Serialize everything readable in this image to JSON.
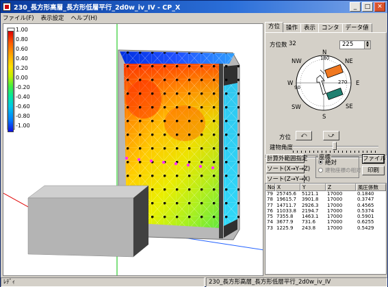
{
  "window": {
    "title": "230_長方形高層_長方形低層平行_2d0w_iv_IV - CP_X",
    "buttons": {
      "minimize": "_",
      "maximize": "□",
      "close": "✕"
    }
  },
  "menu": [
    "ファイル(F)",
    "表示設定",
    "ヘルプ(H)"
  ],
  "legend": {
    "labels": [
      "1.00",
      "0.80",
      "0.60",
      "0.40",
      "0.20",
      "0.00",
      "-0.20",
      "-0.40",
      "-0.60",
      "-0.80",
      "-1.00"
    ],
    "colors": {
      "high": "#e00000",
      "mid": "#ffe000",
      "low": "#1010e0"
    }
  },
  "tabs": [
    "方位",
    "操作",
    "表示",
    "コンタ",
    "データ値"
  ],
  "direction": {
    "count_label": "方位数",
    "count_value": "32",
    "angle_value": "225",
    "compass": [
      "N",
      "NE",
      "E",
      "SE",
      "S",
      "SW",
      "W",
      "NW"
    ],
    "compass_ticks": [
      "180",
      "90",
      "270"
    ],
    "direction_label": "方位",
    "rotate_left": "⤺",
    "rotate_right": "⤻",
    "building_angle_label": "建物角度"
  },
  "actions": {
    "range_button": "計算外範囲指定",
    "sort_xyz_button": "ソート(X→Y→Z)",
    "sort_zyx_button": "ソート(Z→Y→X)",
    "coords_group": "座標",
    "coords_absolute": "絶対",
    "coords_relative": "建物座標の相対",
    "file_button": "ファイル",
    "print_button": "印刷"
  },
  "table": {
    "headers": [
      "No",
      "X",
      "Y",
      "Z",
      "風圧係数"
    ],
    "rows": [
      [
        "79",
        "25745.6",
        "5121.1",
        "17000",
        "0.1840"
      ],
      [
        "78",
        "19615.7",
        "3901.8",
        "17000",
        "0.3747"
      ],
      [
        "77",
        "14711.7",
        "2926.3",
        "17000",
        "0.4565"
      ],
      [
        "76",
        "11033.8",
        "2194.7",
        "17000",
        "0.5374"
      ],
      [
        "75",
        "7355.8",
        "1463.1",
        "17000",
        "0.5901"
      ],
      [
        "74",
        "3677.9",
        "731.6",
        "17000",
        "0.6255"
      ],
      [
        "73",
        "1225.9",
        "243.8",
        "17000",
        "0.5429"
      ]
    ]
  },
  "status": {
    "left": "ﾚﾃﾞｨ",
    "right": "230_長方形高層_長方形低層平行_2d0w_iv_IV"
  }
}
